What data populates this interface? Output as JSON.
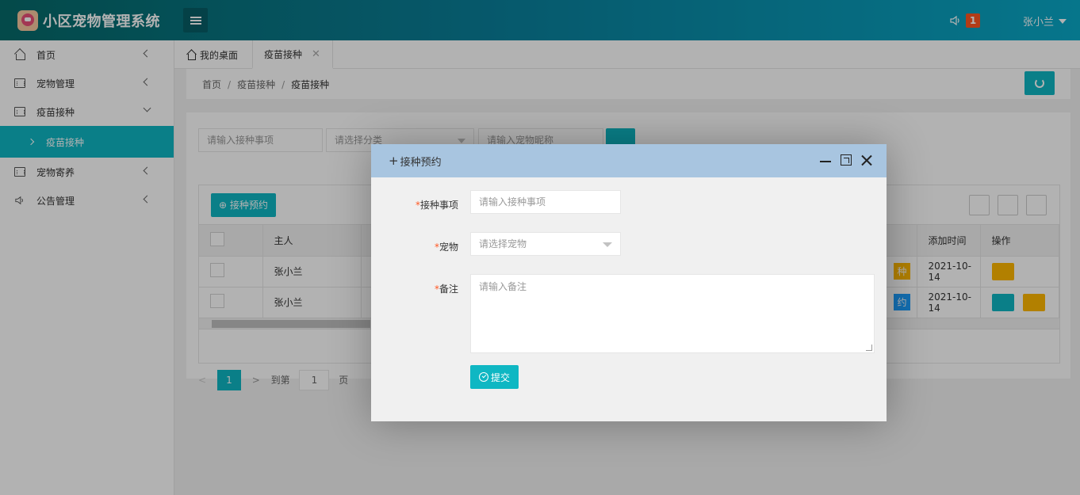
{
  "header": {
    "title": "小区宠物管理系统",
    "notification_count": "1",
    "user_name": "张小兰"
  },
  "sidebar": {
    "items": [
      {
        "label": "首页",
        "icon": "home-icon"
      },
      {
        "label": "宠物管理",
        "icon": "calendar-icon"
      },
      {
        "label": "疫苗接种",
        "icon": "calendar-icon",
        "expanded": true
      },
      {
        "label": "疫苗接种",
        "icon": "chevron-right-icon",
        "active": true
      },
      {
        "label": "宠物寄养",
        "icon": "calendar-icon"
      },
      {
        "label": "公告管理",
        "icon": "speaker-icon"
      }
    ]
  },
  "tabs": [
    {
      "label": "我的桌面"
    },
    {
      "label": "疫苗接种",
      "active": true
    }
  ],
  "breadcrumb": [
    "首页",
    "疫苗接种",
    "疫苗接种"
  ],
  "search": {
    "item_placeholder": "请输入接种事项",
    "category_placeholder": "请选择分类",
    "nickname_placeholder": "请输入宠物昵称"
  },
  "table": {
    "add_button": "接种预约",
    "headers": {
      "owner": "主人",
      "added_time": "添加时间",
      "actions": "操作"
    },
    "rows": [
      {
        "owner": "张小兰",
        "status": "种",
        "added_time": "2021-10-14"
      },
      {
        "owner": "张小兰",
        "status": "约",
        "added_time": "2021-10-14"
      }
    ]
  },
  "pager": {
    "current": "1",
    "goto_label": "到第",
    "page_value": "1",
    "page_unit": "页"
  },
  "modal": {
    "title": "接种预约",
    "fields": {
      "item_label": "接种事项",
      "item_placeholder": "请输入接种事项",
      "pet_label": "宠物",
      "pet_placeholder": "请选择宠物",
      "note_label": "备注",
      "note_placeholder": "请输入备注"
    },
    "submit": "提交"
  },
  "colors": {
    "accent": "#0fb7c3",
    "badge": "#ff5722",
    "modal_title_bg": "#a8c5e0"
  }
}
